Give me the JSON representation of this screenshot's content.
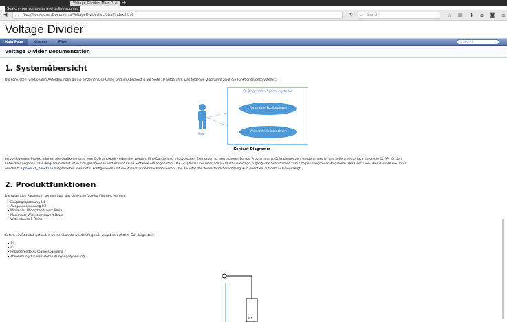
{
  "browser": {
    "tab_title": "Voltage Divider: Main P...",
    "tab_close": "×",
    "new_tab": "+",
    "tooltip": "Search your computer and online sources",
    "url": "file:///home/user/Documents/VoltageDivider/src/html/index.html",
    "search_placeholder": "Search",
    "icons": [
      "back-icon",
      "info-icon",
      "reload-icon",
      "search-icon",
      "star-icon",
      "reading-list-icon",
      "download-icon",
      "home-icon",
      "pocket-icon",
      "menu-icon"
    ]
  },
  "doxygen": {
    "project_name": "Voltage Divider",
    "tabs": [
      {
        "label": "Main Page",
        "active": true
      },
      {
        "label": "Classes",
        "active": false
      },
      {
        "label": "Files",
        "active": false
      }
    ],
    "search_placeholder": "Search",
    "page_title": "Voltage Divider Documentation"
  },
  "section1": {
    "heading": "1. Systemübersicht",
    "intro": "Die konkreten funktionalen Anforderungen an die einzelnen Use Cases sind im Abschnitt 4 auf Seite 10 aufgeführt. Das folgende Diagramm zeigt die Funktionen des Systems:",
    "diagram": {
      "system_title": "Qt Programm - Spannungsteiler",
      "use_case_1": "Parameter konfigurieren",
      "use_case_2": "Widerstände berechnen",
      "actor": "User",
      "caption": "Kontext-Diagramm"
    },
    "para_line1": "Im vorliegenden Projekt können alle Grafikelemente vom Qt-Framework verwendet werden. Eine Darstellung mit typischen Elementen ist ausreichend. Da das Programm mit Qt implementiert werden muss ist das Software Interface durch die Qt API für den",
    "para_line2": "Entwickler gegeben. Das Programm selbst ist in sich geschlossen und es wird keine Software API angeboten. Das Graphical User Interface (GUI) ist die einzige zugängliche Schnittstelle zum Qt Spannungsteiler Programm. Der User kann über das GUI die unter",
    "para_line3_pre": "Abschnitt 2 ",
    "para_line3_link": "product_function",
    "para_line3_post": " aufgelisteten Parameter konfigurieren und die Widerstände berechnen lassen. Das Resultat der Widerstandsberechnung wird ebenfalls auf dem GUI angezeigt."
  },
  "section2": {
    "heading": "2. Produktfunktionen",
    "intro": "Die folgenden Parameter können über das User-Interface konfiguriert werden:",
    "params": [
      {
        "text": "Eingangsspannung ",
        "math": "U1"
      },
      {
        "text": "Ausgangsspannung ",
        "math": "U2"
      },
      {
        "text": "Minimaler Widerstandswert ",
        "math": "Rmin"
      },
      {
        "text": "Maximaler Widerstandswert ",
        "math": "Rmax"
      },
      {
        "text": "Widerstands-E-Reihe",
        "math": ""
      }
    ],
    "results_intro": "Sofern ein Resultat gefunden werden konnte werden folgende Angaben auf dem GUI dargestellt:",
    "results": [
      {
        "text": "",
        "math": "R1"
      },
      {
        "text": "",
        "math": "R2"
      },
      {
        "text": "Resultierende Ausgangsspannung",
        "math": ""
      },
      {
        "text": "Abweichung zur erwarteten Ausgangsspannung",
        "math": ""
      }
    ],
    "circuit_label": "R 1"
  }
}
